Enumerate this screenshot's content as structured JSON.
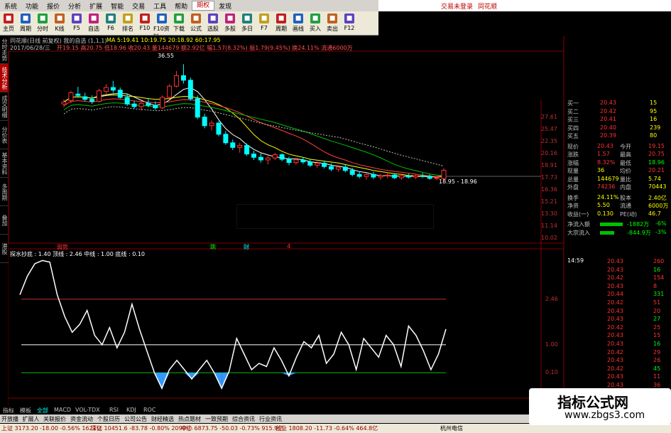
{
  "menu": [
    "系统",
    "功能",
    "报价",
    "分析",
    "扩展",
    "智能",
    "交易",
    "工具",
    "帮助",
    "期权",
    "发现"
  ],
  "menu_active_index": 9,
  "topright": {
    "login": "交易未登录",
    "brand": "同花顺"
  },
  "toolbar": [
    "主页",
    "周期",
    "分时",
    "K线",
    "F5",
    "自选",
    "F6",
    "排名",
    "F10",
    "F10资料",
    "下载",
    "公式",
    "选股",
    "多股",
    "多日",
    "F7",
    "周期",
    "画线",
    "买入",
    "卖出",
    "F12"
  ],
  "lefttabs": [
    "分时走势",
    "技术分析",
    "成交明细",
    "分价表",
    "基本资料",
    "多周期",
    "叠加",
    "港股"
  ],
  "chart_header": {
    "title": "同花顺(日线 前复权) 我的自选 (1,1,1)",
    "date": "2017/06/28/三",
    "ma_line": "MA 5:19.41  10:19.75  20:18.92  60:17.95",
    "price_line": "开19.15 高20.75 低18.96 收20.43 量144679 额2.92亿 幅1.57(8.32%) 振1.79(9.45%) 换24.11% 流通6000万",
    "max_label": "36.55",
    "min_label": "18.95 - 18.96",
    "ind_header": "探水抄底 : 1.40  顶线 : 2.46  中线 : 1.00  底线 : 0.10",
    "markers": [
      "弱势",
      "跳",
      "财",
      "4"
    ]
  },
  "price_axis": [
    "27.61",
    "25.47",
    "22.35",
    "20.16",
    "18.91",
    "17.73",
    "16.36",
    "15.21",
    "13.30",
    "11.14",
    "10.02"
  ],
  "info": [
    {
      "l": "买一",
      "v": "20.43",
      "q": "15"
    },
    {
      "l": "买二",
      "v": "20.42",
      "q": "95"
    },
    {
      "l": "买三",
      "v": "20.41",
      "q": "16"
    },
    {
      "l": "买四",
      "v": "20.40",
      "q": "239"
    },
    {
      "l": "买五",
      "v": "20.39",
      "q": "80"
    },
    {
      "l": "现价",
      "v": "20.43",
      "l2": "今开",
      "v2": "19.15"
    },
    {
      "l": "涨跌",
      "v": "1.57",
      "l2": "最高",
      "v2": "20.75"
    },
    {
      "l": "涨幅",
      "v": "8.32%",
      "l2": "最低",
      "v2": "18.96"
    },
    {
      "l": "现量",
      "v": "36",
      "l2": "均价",
      "v2": "20.21"
    },
    {
      "l": "总量",
      "v": "144679",
      "l2": "量比",
      "v2": "5.74"
    },
    {
      "l": "外盘",
      "v": "74236",
      "l2": "内盘",
      "v2": "70443"
    },
    {
      "l": "换手",
      "v": "24.11%",
      "l2": "股本",
      "v2": "2.40亿"
    },
    {
      "l": "净资",
      "v": "5.50",
      "l2": "流通",
      "v2": "6000万"
    },
    {
      "l": "收益(一)",
      "v": "0.130",
      "l2": "PE(动)",
      "v2": "46.7"
    },
    {
      "l": "净流入额",
      "v": "-1882万",
      "v2": "-6%"
    },
    {
      "l": "大宗流入",
      "v": "-844.9万",
      "v2": "-3%"
    }
  ],
  "ticks_time": "14:59",
  "ticks": [
    [
      "20.43",
      "260"
    ],
    [
      "20.43",
      "16"
    ],
    [
      "20.42",
      "154"
    ],
    [
      "20.43",
      "8"
    ],
    [
      "20.44",
      "331"
    ],
    [
      "20.42",
      "51"
    ],
    [
      "20.43",
      "20"
    ],
    [
      "20.43",
      "27"
    ],
    [
      "20.42",
      "25"
    ],
    [
      "20.43",
      "15"
    ],
    [
      "20.43",
      "16"
    ],
    [
      "20.42",
      "29"
    ],
    [
      "20.43",
      "26"
    ],
    [
      "20.42",
      "45"
    ],
    [
      "20.43",
      "11"
    ],
    [
      "20.43",
      "36"
    ]
  ],
  "ind_axis": [
    "2.46",
    "1.00",
    "0.10"
  ],
  "tabsbar": [
    "指标",
    "模板",
    "全部",
    "MACD",
    "VOL-TDX",
    "RSI",
    "KDJ",
    "ROC"
  ],
  "linksbar": [
    "开放播",
    "扩展人",
    "关联报价",
    "资金流动",
    "个股日历",
    "公司公告",
    "财经精选",
    "热点题材",
    "一致预期",
    "综合资讯",
    "行业资讯"
  ],
  "statusbar": [
    "上证 3173.20 -18.00 -0.56% 1621亿",
    "深证 10451.6 -83.78 -0.80% 2090亿",
    "中小 6873.75 -50.03 -0.73% 915.9亿",
    "创业 1808.20 -11.73 -0.64% 464.8亿",
    "杭州电信"
  ],
  "watermark": {
    "line1": "指标公式网",
    "line2": "www.zbgs3.com"
  },
  "colors": {
    "up": "#ff3232",
    "down": "#00ffff",
    "ma5": "#ffffff",
    "ma10": "#ffff00",
    "ma20": "#ff00ff",
    "ma60": "#00ff00"
  },
  "chart_data": {
    "type": "candlestick",
    "candles": [
      [
        30.5,
        31.2,
        30.0,
        30.8
      ],
      [
        31.0,
        32.5,
        30.6,
        32.2
      ],
      [
        32.0,
        33.1,
        31.4,
        31.8
      ],
      [
        31.6,
        32.2,
        30.9,
        31.2
      ],
      [
        31.2,
        31.8,
        30.5,
        30.9
      ],
      [
        30.9,
        32.8,
        30.7,
        32.5
      ],
      [
        32.4,
        33.5,
        31.9,
        33.0
      ],
      [
        33.0,
        34.0,
        32.2,
        32.6
      ],
      [
        32.6,
        33.0,
        31.3,
        31.5
      ],
      [
        31.5,
        32.0,
        30.2,
        30.5
      ],
      [
        30.5,
        31.0,
        29.8,
        30.1
      ],
      [
        30.1,
        30.8,
        29.5,
        30.6
      ],
      [
        30.6,
        31.4,
        30.0,
        30.3
      ],
      [
        30.3,
        30.9,
        29.6,
        29.9
      ],
      [
        29.9,
        31.8,
        29.7,
        31.5
      ],
      [
        31.5,
        33.5,
        31.2,
        33.2
      ],
      [
        33.2,
        35.5,
        33.0,
        34.8
      ],
      [
        34.8,
        36.55,
        33.6,
        34.1
      ],
      [
        34.1,
        34.5,
        31.0,
        31.3
      ],
      [
        31.3,
        31.8,
        28.2,
        28.5
      ],
      [
        28.5,
        29.0,
        26.8,
        27.2
      ],
      [
        27.2,
        28.0,
        26.5,
        27.6
      ],
      [
        27.6,
        27.9,
        25.6,
        25.9
      ],
      [
        25.9,
        26.4,
        24.3,
        24.6
      ],
      [
        24.6,
        25.1,
        23.5,
        23.9
      ],
      [
        23.9,
        24.6,
        23.1,
        24.2
      ],
      [
        24.2,
        24.5,
        22.6,
        22.9
      ],
      [
        22.9,
        23.4,
        22.0,
        22.4
      ],
      [
        22.4,
        23.0,
        21.6,
        22.0
      ],
      [
        22.0,
        22.6,
        21.3,
        22.3
      ],
      [
        22.3,
        23.1,
        22.0,
        22.8
      ],
      [
        22.8,
        23.0,
        21.8,
        22.1
      ],
      [
        22.1,
        22.5,
        21.2,
        21.6
      ],
      [
        21.6,
        22.3,
        21.3,
        22.0
      ],
      [
        22.0,
        22.4,
        21.4,
        21.7
      ],
      [
        21.7,
        22.1,
        20.9,
        21.2
      ],
      [
        21.2,
        21.8,
        20.8,
        21.5
      ],
      [
        21.5,
        21.9,
        20.7,
        21.0
      ],
      [
        21.0,
        21.5,
        20.3,
        20.6
      ],
      [
        20.6,
        21.2,
        20.2,
        20.9
      ],
      [
        20.9,
        21.3,
        20.1,
        20.4
      ],
      [
        20.4,
        20.8,
        19.5,
        19.8
      ],
      [
        19.8,
        20.3,
        19.2,
        19.5
      ],
      [
        19.5,
        20.0,
        19.0,
        19.8
      ],
      [
        19.8,
        20.2,
        19.1,
        19.4
      ],
      [
        19.4,
        19.9,
        18.95,
        19.6
      ],
      [
        19.6,
        20.1,
        19.2,
        19.7
      ],
      [
        19.7,
        20.0,
        19.1,
        19.3
      ],
      [
        19.3,
        19.8,
        19.0,
        19.6
      ],
      [
        19.6,
        19.9,
        19.2,
        19.4
      ],
      [
        19.4,
        19.8,
        19.1,
        19.6
      ],
      [
        19.6,
        20.0,
        19.3,
        19.5
      ],
      [
        19.5,
        19.8,
        19.0,
        19.2
      ],
      [
        19.2,
        19.6,
        18.96,
        19.3
      ],
      [
        19.15,
        20.75,
        18.96,
        20.43
      ]
    ],
    "indicator": {
      "name": "探水抄底",
      "top": 2.46,
      "mid": 1.0,
      "bottom": 0.1,
      "values": [
        2.6,
        3.2,
        3.6,
        3.7,
        3.65,
        2.6,
        1.9,
        1.4,
        1.65,
        2.1,
        1.3,
        1.0,
        1.55,
        0.9,
        1.4,
        2.3,
        1.5,
        0.8,
        0.1,
        -0.4,
        0.2,
        0.5,
        0.2,
        -0.1,
        0.2,
        0.5,
        0.1,
        -0.4,
        0.15,
        1.2,
        0.7,
        0.2,
        0.4,
        0.3,
        0.9,
        0.5,
        0.0,
        0.6,
        1.1,
        0.9,
        1.3,
        0.4,
        0.7,
        1.4,
        1.0,
        0.2,
        1.2,
        0.9,
        0.6,
        1.3,
        1.0,
        0.3,
        1.6,
        1.3,
        0.8,
        0.2,
        0.7,
        1.5
      ]
    }
  }
}
